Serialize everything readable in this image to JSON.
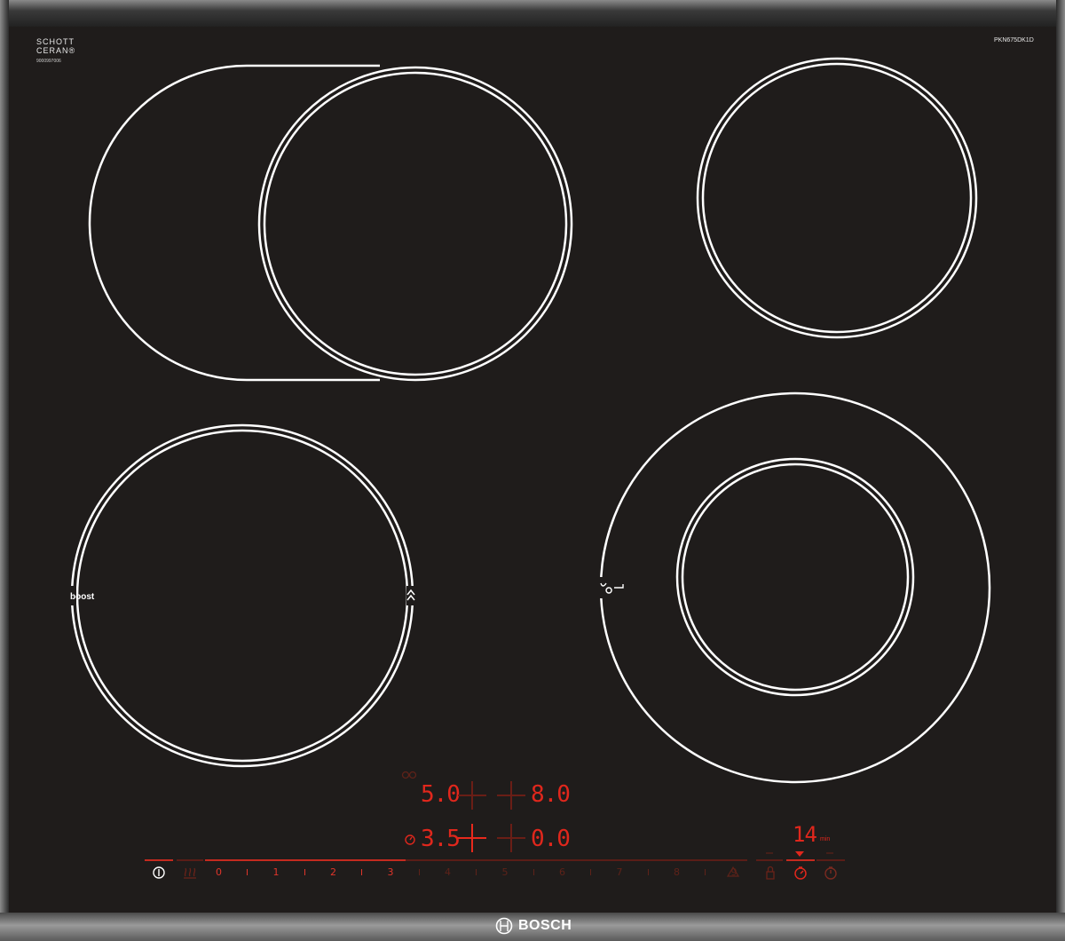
{
  "appliance": {
    "brand": "BOSCH",
    "glass_brand_line1": "SCHOTT",
    "glass_brand_line2": "CERAN®",
    "glass_code": "9000997006",
    "model": "PKN675DK1D",
    "colors": {
      "glass": "#1f1c1b",
      "zone_outline": "#ffffff",
      "display_red": "#e0271c",
      "display_dim": "#5e2219"
    }
  },
  "zones": {
    "boost_label": "boost",
    "boost_icon": "double-chevron-up-icon",
    "roast_icon": "roasting-zone-icon"
  },
  "displays": {
    "top_left": "5.0",
    "top_right": "8.0",
    "bottom_left": "3.5",
    "bottom_right": "0.0",
    "timer_value": "14",
    "timer_unit": "min"
  },
  "control_panel": {
    "power_icon": "power-icon",
    "keep_warm_icon": "keep-warm-icon",
    "power_levels": [
      "0",
      "1",
      "2",
      "3",
      "4",
      "5",
      "6",
      "7",
      "8",
      "9"
    ],
    "active_level": 3,
    "right_icons": [
      "lock-icon",
      "timer-icon",
      "stopwatch-icon"
    ]
  }
}
